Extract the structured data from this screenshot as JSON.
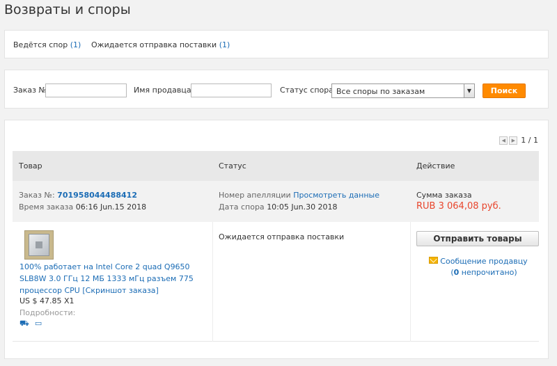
{
  "page": {
    "title": "Возвраты и споры"
  },
  "tabs": [
    {
      "label": "Ведётся спор",
      "count": "(1)"
    },
    {
      "label": "Ожидается отправка поставки",
      "count": "(1)"
    }
  ],
  "search": {
    "order_label": "Заказ №:",
    "order_value": "",
    "seller_label": "Имя продавца :",
    "seller_value": "",
    "status_label": "Статус спора:",
    "status_selected": "Все споры по заказам",
    "button_label": "Поиск"
  },
  "pager": {
    "prev_icon": "chevron-left-icon",
    "next_icon": "chevron-right-icon",
    "text": "1 / 1"
  },
  "table": {
    "headers": {
      "product": "Товар",
      "status": "Статус",
      "action": "Действие"
    }
  },
  "order": {
    "number_label": "Заказ №:",
    "number": "701958044488412",
    "time_label": "Время заказа",
    "time": "06:16 Jun.15 2018",
    "appeal_label": "Номер апелляции",
    "appeal_link": "Просмотреть данные",
    "dispute_date_label": "Дата спора",
    "dispute_date": "10:05 Jun.30 2018",
    "total_label": "Сумма заказа",
    "total_value": "RUB 3 064,08 руб."
  },
  "item": {
    "title": "100% работает на Intel Core 2 quad Q9650 SLB8W 3.0 ГГц 12 МБ 1333 мГц разъем 775 процессор CPU",
    "snapshot": "[Скриншот заказа]",
    "price": "US $ 47.85 X1",
    "details_label": "Подробности:",
    "status": "Ожидается отправка поставки",
    "ship_button": "Отправить товары",
    "message_link": "Сообщение продавцу",
    "unread_prefix": "(",
    "unread_count": "0",
    "unread_suffix": " непрочитано)"
  },
  "icons": [
    "truck-icon",
    "card-icon",
    "envelope-icon"
  ],
  "colors": {
    "accent_link": "#1b6cb5",
    "search_button": "#ff8a00",
    "price_red": "#e8452c",
    "envelope": "#f5b400"
  }
}
